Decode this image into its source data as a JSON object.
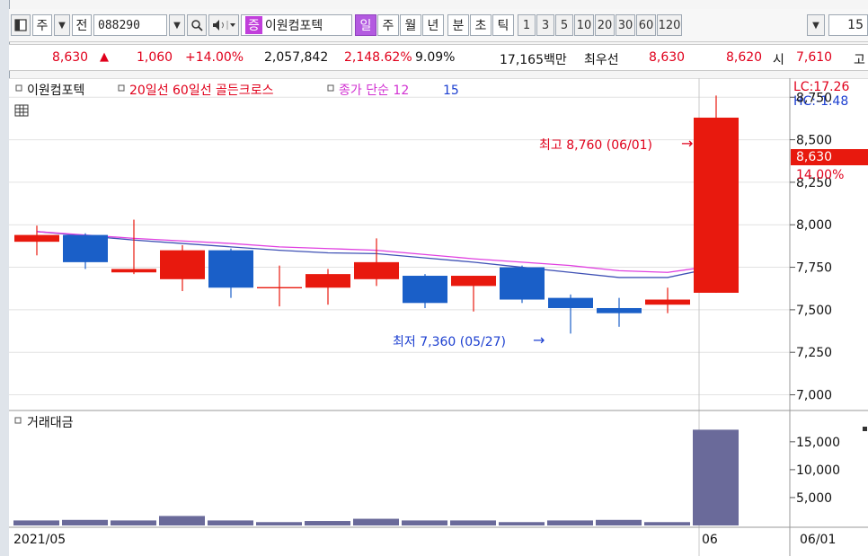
{
  "toolbar": {
    "layout_icon": "window-icon",
    "market_label": "주",
    "dropdown_arrow": "▼",
    "scope_label": "전",
    "stock_code": "088290",
    "search_icon": "search-icon",
    "speaker_icon": "speaker-icon",
    "stock_name_prefix": "증",
    "stock_name": "이원컴포텍",
    "periods": [
      "일",
      "주",
      "월",
      "년",
      "분",
      "초",
      "틱"
    ],
    "active_period": "일",
    "intervals": [
      "1",
      "3",
      "5",
      "10",
      "20",
      "30",
      "60",
      "120"
    ],
    "count_value": "15"
  },
  "quote": {
    "price": "8,630",
    "direction_icon": "▲",
    "change": "1,060",
    "change_pct": "+14.00%",
    "volume": "2,057,842",
    "volume_ratio": "2,148.62%",
    "turnover": "9.09%",
    "amount": "17,165백만",
    "priority_label": "최우선",
    "ask": "8,630",
    "bid": "8,620",
    "open_label": "시",
    "open": "7,610",
    "high_label": "고"
  },
  "chart": {
    "legend_name": "이원컴포텍",
    "legend_indicator": "20일선 60일선 골든크로스",
    "legend_ma_label": "종가 단순 12",
    "legend_ma_period": "15",
    "lc_label": "LC:17.26",
    "hc_label": "HC:-1.48",
    "current_price": "8,630",
    "current_pct": "14.00%",
    "max_label": "최고 8,760 (06/01)",
    "min_label": "최저 7,360 (05/27)",
    "arrow_right": "→",
    "volume_legend": "거래대금",
    "x_left": "2021/05",
    "x_mid": "06",
    "x_right": "06/01",
    "colors": {
      "up": "#e8190e",
      "down": "#1a5fc8",
      "ma": "#e040e0",
      "ma2": "#3f51b5",
      "volume": "#6a6a9a"
    }
  },
  "chart_data": {
    "type": "candlestick",
    "price_ticks": [
      "8,750",
      "8,500",
      "8,250",
      "8,000",
      "7,750",
      "7,500",
      "7,250",
      "7,000"
    ],
    "price_tick_values": [
      8750,
      8500,
      8250,
      8000,
      7750,
      7500,
      7250,
      7000
    ],
    "ylim": [
      6950,
      8820
    ],
    "volume_ticks": [
      "15,000",
      "10,000",
      "5,000"
    ],
    "volume_tick_values": [
      15000,
      10000,
      5000
    ],
    "volume_ylim": [
      0,
      19000
    ],
    "candles": [
      {
        "o": 7900,
        "h": 7995,
        "l": 7820,
        "c": 7940
      },
      {
        "o": 7940,
        "h": 7950,
        "l": 7740,
        "c": 7780
      },
      {
        "o": 7720,
        "h": 8030,
        "l": 7710,
        "c": 7740
      },
      {
        "o": 7680,
        "h": 7880,
        "l": 7610,
        "c": 7850
      },
      {
        "o": 7850,
        "h": 7860,
        "l": 7570,
        "c": 7630
      },
      {
        "o": 7630,
        "h": 7760,
        "l": 7520,
        "c": 7630
      },
      {
        "o": 7630,
        "h": 7740,
        "l": 7530,
        "c": 7710
      },
      {
        "o": 7680,
        "h": 7920,
        "l": 7640,
        "c": 7780
      },
      {
        "o": 7700,
        "h": 7710,
        "l": 7510,
        "c": 7540
      },
      {
        "o": 7640,
        "h": 7700,
        "l": 7490,
        "c": 7700
      },
      {
        "o": 7750,
        "h": 7760,
        "l": 7540,
        "c": 7560
      },
      {
        "o": 7570,
        "h": 7590,
        "l": 7360,
        "c": 7510
      },
      {
        "o": 7510,
        "h": 7570,
        "l": 7400,
        "c": 7480
      },
      {
        "o": 7530,
        "h": 7630,
        "l": 7480,
        "c": 7560
      },
      {
        "o": 7600,
        "h": 8760,
        "l": 7600,
        "c": 8630
      }
    ],
    "ma_short": [
      7960,
      7940,
      7920,
      7905,
      7890,
      7870,
      7860,
      7850,
      7825,
      7800,
      7780,
      7760,
      7730,
      7720,
      7760
    ],
    "ma_long": [
      7960,
      7935,
      7910,
      7890,
      7870,
      7850,
      7835,
      7830,
      7805,
      7780,
      7750,
      7720,
      7690,
      7690,
      7750
    ],
    "volume": [
      900,
      1000,
      900,
      1700,
      900,
      600,
      800,
      1200,
      900,
      900,
      600,
      900,
      1000,
      600,
      17165
    ]
  }
}
